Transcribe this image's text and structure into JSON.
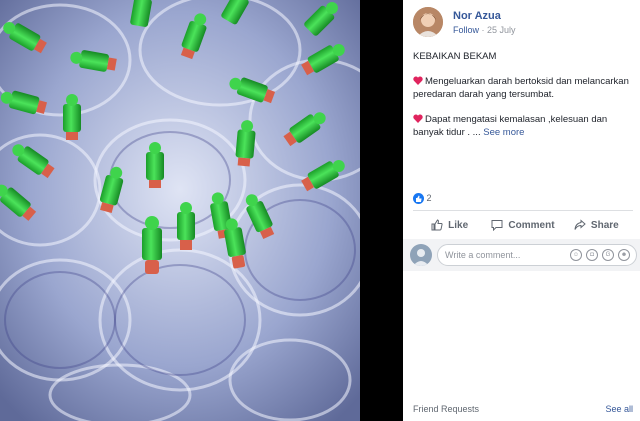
{
  "post": {
    "author": "Nor Azua",
    "follow_label": "Follow",
    "date": "25 July",
    "title": "KEBAIKAN BEKAM",
    "paragraph1": "Mengeluarkan darah bertoksid dan melancarkan peredaran darah yang tersumbat.",
    "paragraph2": "Dapat mengatasi kemalasan ,kelesuan dan banyak tidur . ...",
    "see_more": "See more",
    "reaction_count": "2"
  },
  "actions": {
    "like": "Like",
    "comment": "Comment",
    "share": "Share"
  },
  "comment_box": {
    "placeholder": "Write a comment..."
  },
  "footer": {
    "friend_requests": "Friend Requests",
    "see_all": "See all"
  },
  "colors": {
    "link": "#365899",
    "heart": "#e0245e",
    "like": "#1877f2",
    "cap_green": "#2fc23a"
  }
}
